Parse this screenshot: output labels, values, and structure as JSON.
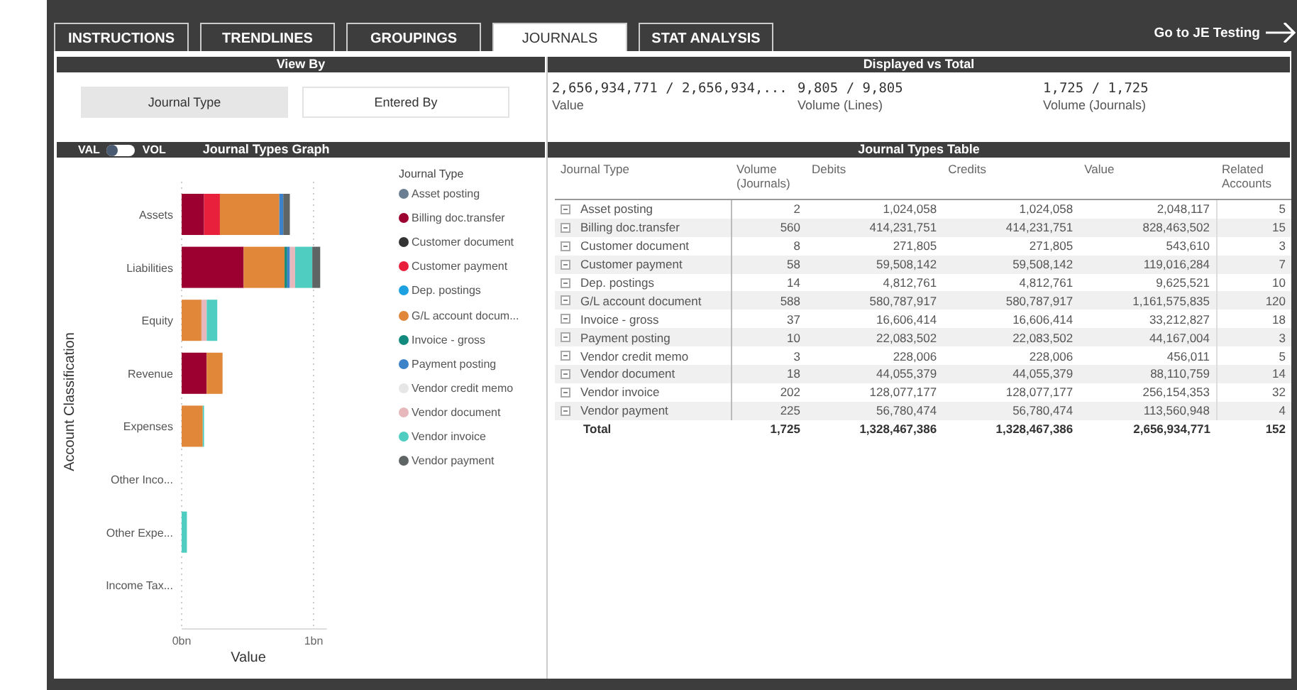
{
  "tabs": [
    {
      "label": "INSTRUCTIONS",
      "selected": false
    },
    {
      "label": "TRENDLINES",
      "selected": false
    },
    {
      "label": "GROUPINGS",
      "selected": false
    },
    {
      "label": "JOURNALS",
      "selected": true
    },
    {
      "label": "STAT ANALYSIS",
      "selected": false
    }
  ],
  "nav_link": "Go to JE Testing",
  "view_by": {
    "title": "View By",
    "options": [
      {
        "label": "Journal Type",
        "selected": true
      },
      {
        "label": "Entered By",
        "selected": false
      }
    ]
  },
  "displayed_vs_total": {
    "title": "Displayed vs Total",
    "stats": [
      {
        "value": "2,656,934,771 / 2,656,934,...",
        "label": "Value"
      },
      {
        "value": "9,805 / 9,805",
        "label": "Volume (Lines)"
      },
      {
        "value": "1,725 / 1,725",
        "label": "Volume (Journals)"
      }
    ]
  },
  "graph": {
    "title": "Journal Types Graph",
    "toggle": {
      "left_label": "VAL",
      "right_label": "VOL",
      "on": false
    },
    "chart_data": {
      "type": "bar",
      "orientation": "horizontal",
      "stacked": true,
      "xlabel": "Value",
      "ylabel": "Account Classification",
      "legend": {
        "title": "Journal Type"
      },
      "xlim": [
        0,
        1.1
      ],
      "categories": [
        "Assets",
        "Liabilities",
        "Equity",
        "Revenue",
        "Expenses",
        "Other Inco...",
        "Other Expe...",
        "Income Tax..."
      ],
      "xticks": [
        {
          "value": 0,
          "label": "0bn"
        },
        {
          "value": 1,
          "label": "1bn"
        }
      ],
      "series": [
        {
          "name": "Asset posting",
          "color": "#6a7f92",
          "values": [
            0,
            0,
            0,
            0,
            0,
            0,
            0,
            0
          ]
        },
        {
          "name": "Billing doc.transfer",
          "color": "#9b0030",
          "values": [
            0.17,
            0.47,
            0,
            0.19,
            0,
            0,
            0,
            0
          ]
        },
        {
          "name": "Customer document",
          "color": "#333333",
          "values": [
            0,
            0,
            0,
            0,
            0,
            0,
            0,
            0
          ]
        },
        {
          "name": "Customer payment",
          "color": "#e8203c",
          "values": [
            0.12,
            0,
            0,
            0,
            0,
            0,
            0,
            0
          ]
        },
        {
          "name": "Dep. postings",
          "color": "#1ea1e0",
          "values": [
            0,
            0,
            0,
            0,
            0,
            0,
            0,
            0
          ]
        },
        {
          "name": "G/L account docum...",
          "color": "#e0873a",
          "values": [
            0.45,
            0.31,
            0.15,
            0.12,
            0.16,
            0,
            0,
            0
          ]
        },
        {
          "name": "Invoice - gross",
          "color": "#138a7e",
          "values": [
            0,
            0.02,
            0,
            0,
            0,
            0,
            0,
            0
          ]
        },
        {
          "name": "Payment posting",
          "color": "#3b82c8",
          "values": [
            0.03,
            0.02,
            0,
            0,
            0,
            0,
            0,
            0
          ]
        },
        {
          "name": "Vendor credit memo",
          "color": "#e6e6e6",
          "values": [
            0,
            0,
            0,
            0,
            0,
            0,
            0,
            0
          ]
        },
        {
          "name": "Vendor document",
          "color": "#e6b8bc",
          "values": [
            0,
            0.04,
            0.04,
            0,
            0,
            0,
            0,
            0
          ]
        },
        {
          "name": "Vendor invoice",
          "color": "#4ecdc0",
          "values": [
            0,
            0.13,
            0.08,
            0,
            0.01,
            0,
            0.04,
            0
          ]
        },
        {
          "name": "Vendor payment",
          "color": "#5f6465",
          "values": [
            0.05,
            0.06,
            0,
            0,
            0,
            0,
            0,
            0
          ]
        }
      ]
    }
  },
  "table": {
    "title": "Journal Types Table",
    "columns": [
      "Journal Type",
      "Volume (Journals)",
      "Debits",
      "Credits",
      "Value",
      "Related Accounts"
    ],
    "rows": [
      [
        "Asset posting",
        "2",
        "1,024,058",
        "1,024,058",
        "2,048,117",
        "5"
      ],
      [
        "Billing doc.transfer",
        "560",
        "414,231,751",
        "414,231,751",
        "828,463,502",
        "15"
      ],
      [
        "Customer document",
        "8",
        "271,805",
        "271,805",
        "543,610",
        "3"
      ],
      [
        "Customer payment",
        "58",
        "59,508,142",
        "59,508,142",
        "119,016,284",
        "7"
      ],
      [
        "Dep. postings",
        "14",
        "4,812,761",
        "4,812,761",
        "9,625,521",
        "10"
      ],
      [
        "G/L account document",
        "588",
        "580,787,917",
        "580,787,917",
        "1,161,575,835",
        "120"
      ],
      [
        "Invoice - gross",
        "37",
        "16,606,414",
        "16,606,414",
        "33,212,827",
        "18"
      ],
      [
        "Payment posting",
        "10",
        "22,083,502",
        "22,083,502",
        "44,167,004",
        "3"
      ],
      [
        "Vendor credit memo",
        "3",
        "228,006",
        "228,006",
        "456,011",
        "5"
      ],
      [
        "Vendor document",
        "18",
        "44,055,379",
        "44,055,379",
        "88,110,759",
        "14"
      ],
      [
        "Vendor invoice",
        "202",
        "128,077,177",
        "128,077,177",
        "256,154,353",
        "32"
      ],
      [
        "Vendor payment",
        "225",
        "56,780,474",
        "56,780,474",
        "113,560,948",
        "4"
      ]
    ],
    "total": [
      "Total",
      "1,725",
      "1,328,467,386",
      "1,328,467,386",
      "2,656,934,771",
      "152"
    ]
  }
}
